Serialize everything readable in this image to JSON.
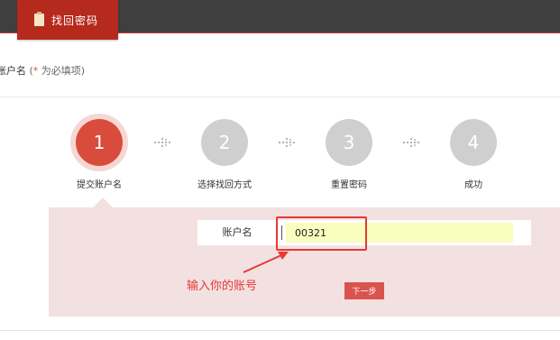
{
  "header": {
    "tab_label": "找回密码",
    "tab_icon": "clipboard-icon"
  },
  "form": {
    "title": "账户名",
    "required_note_open": "(",
    "required_asterisk": "*",
    "required_note_text": " 为必填项)"
  },
  "steps": [
    {
      "number": "1",
      "label": "提交账户名",
      "active": true
    },
    {
      "number": "2",
      "label": "选择找回方式",
      "active": false
    },
    {
      "number": "3",
      "label": "重置密码",
      "active": false
    },
    {
      "number": "4",
      "label": "成功",
      "active": false
    }
  ],
  "field": {
    "label": "账户名",
    "value": "00321"
  },
  "annotation": {
    "text": "输入你的账号",
    "color": "#e53935"
  },
  "next_button_label": "下一步",
  "colors": {
    "topbar": "#3f3f3f",
    "tab": "#b52a1d",
    "step_active": "#d94c3c",
    "step_inactive": "#cfcfcf",
    "panel": "#f3e1e1",
    "input_bg": "#fbfdbe"
  }
}
